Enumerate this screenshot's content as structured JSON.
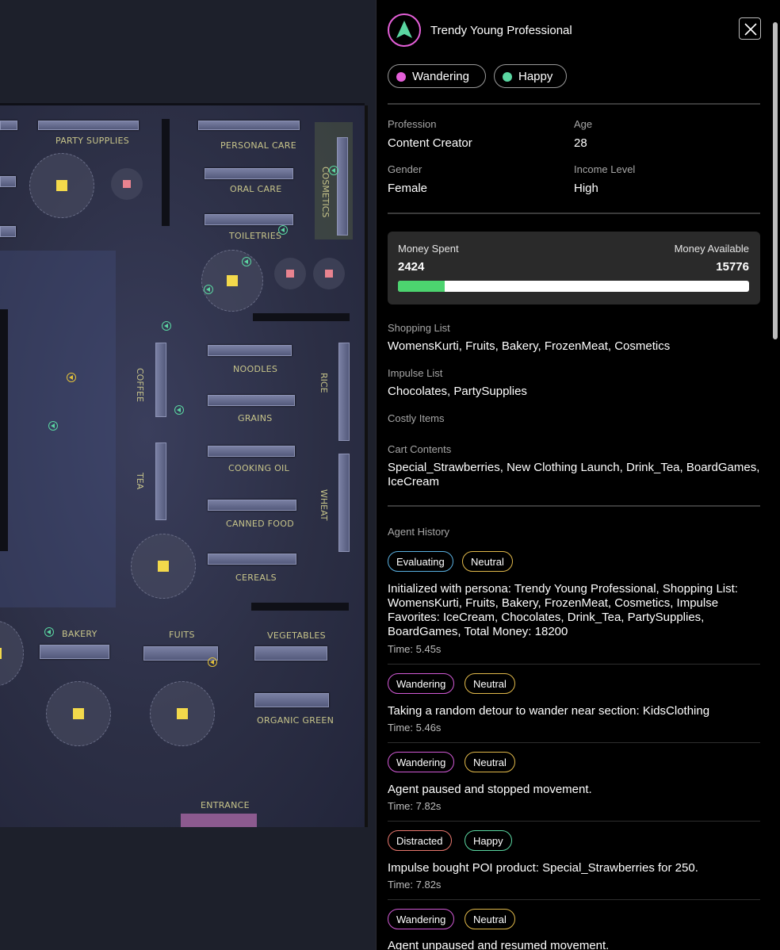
{
  "agent": {
    "name": "Trendy Young Professional",
    "states": [
      {
        "label": "Wandering",
        "color": "#e45fd8"
      },
      {
        "label": "Happy",
        "color": "#5ad6a1"
      }
    ],
    "details": {
      "profession_label": "Profession",
      "profession": "Content Creator",
      "age_label": "Age",
      "age": "28",
      "gender_label": "Gender",
      "gender": "Female",
      "income_label": "Income Level",
      "income": "High"
    },
    "money": {
      "spent_label": "Money Spent",
      "spent": "2424",
      "available_label": "Money Available",
      "available": "15776",
      "spent_fraction": 0.133
    },
    "shopping_list_label": "Shopping List",
    "shopping_list": "WomensKurti, Fruits, Bakery, FrozenMeat, Cosmetics",
    "impulse_list_label": "Impulse List",
    "impulse_list": "Chocolates, PartySupplies",
    "costly_items_label": "Costly Items",
    "cart_label": "Cart Contents",
    "cart": "Special_Strawberries, New Clothing Launch, Drink_Tea, BoardGames, IceCream",
    "history_label": "Agent History",
    "history": [
      {
        "tags": [
          "Evaluating",
          "Neutral"
        ],
        "text": "Initialized with persona: Trendy Young Professional, Shopping List: WomensKurti, Fruits, Bakery, FrozenMeat, Cosmetics, Impulse Favorites: IceCream, Chocolates, Drink_Tea, PartySupplies, BoardGames, Total Money: 18200",
        "time": "Time: 5.45s"
      },
      {
        "tags": [
          "Wandering",
          "Neutral"
        ],
        "text": "Taking a random detour to wander near section: KidsClothing",
        "time": "Time: 5.46s"
      },
      {
        "tags": [
          "Wandering",
          "Neutral"
        ],
        "text": "Agent paused and stopped movement.",
        "time": "Time: 7.82s"
      },
      {
        "tags": [
          "Distracted",
          "Happy"
        ],
        "text": "Impulse bought POI product: Special_Strawberries for 250.",
        "time": "Time: 7.82s"
      },
      {
        "tags": [
          "Wandering",
          "Neutral"
        ],
        "text": "Agent unpaused and resumed movement.",
        "time": ""
      }
    ]
  },
  "map": {
    "sections": {
      "party": "PARTY SUPPLIES",
      "personal": "PERSONAL CARE",
      "oral": "ORAL CARE",
      "cosmetics": "COSMETICS",
      "toiletries": "TOILETRIES",
      "coffee": "COFFEE",
      "noodles": "NOODLES",
      "rice": "RICE",
      "grains": "GRAINS",
      "tea": "TEA",
      "cooking": "COOKING OIL",
      "wheat": "WHEAT",
      "canned": "CANNED FOOD",
      "cereals": "CEREALS",
      "bakery": "BAKERY",
      "fuits": "FUITS",
      "vegetables": "VEGETABLES",
      "organic": "ORGANIC GREEN",
      "entrance": "ENTRANCE"
    }
  },
  "colors": {
    "accent": "#e45fd8",
    "progress": "#4cd46f",
    "agent_marker": "#5ad6a1"
  }
}
